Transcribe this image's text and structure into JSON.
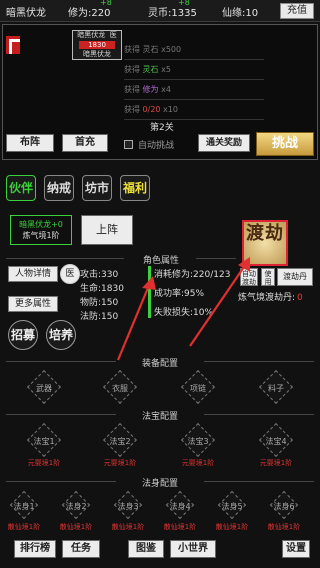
{
  "topbar": {
    "name": "暗黑伏龙",
    "cultivation_label": "修为:220",
    "cultivation_gain": "+8",
    "spirit_label": "灵币:1335",
    "spirit_gain": "+8",
    "immortal_label": "仙缘:10",
    "recharge": "充值"
  },
  "battle": {
    "player_name": "暗黑伏龙  医",
    "player_hp": "1830",
    "player_rank": "暗黑伏龙",
    "logs": [
      {
        "prefix": "获得 ",
        "item": "灵石",
        "suffix": " x500",
        "color": "gray"
      },
      {
        "prefix": "获得 ",
        "item": "灵石",
        "suffix": " x5",
        "color": "green"
      },
      {
        "prefix": "获得 ",
        "item": "修为",
        "suffix": " x4",
        "color": "purple"
      },
      {
        "prefix": "获得 ",
        "item": "0/20",
        "suffix": " x10",
        "color": "red"
      }
    ],
    "stage": "第2关",
    "formation": "布阵",
    "first_recharge": "首充",
    "auto_challenge": "自动挑战",
    "clear_reward": "通关奖励",
    "challenge": "挑战"
  },
  "tabs": [
    "伙伴",
    "纳戒",
    "坊市",
    "福利"
  ],
  "party": {
    "member_name": "暗黑伏龙+0",
    "member_realm": "炼气境1阶",
    "deploy": "上阵"
  },
  "attributes": {
    "title": "角色属性",
    "details_btn": "人物详情",
    "role_btn": "医",
    "more_btn": "更多属性",
    "recruit_btn": "招募",
    "train_btn": "培养",
    "attack": "攻击:330",
    "hp": "生命:1830",
    "phys_def": "物防:150",
    "magic_def": "法防:150",
    "consume": "消耗修为:220/123",
    "success": "成功率:95%",
    "fail_loss": "失败损失:10%"
  },
  "tribulation": {
    "label": "渡劫",
    "auto_btn": "自动渡劫",
    "use_btn": "使用",
    "pill_btn": "渡劫丹",
    "realm_text": "炼气境渡劫丹:",
    "realm_count": "0"
  },
  "equipment": {
    "title": "装备配置",
    "slots": [
      "武器",
      "衣服",
      "项链",
      "料子"
    ]
  },
  "treasure": {
    "title": "法宝配置",
    "slots": [
      "法宝1",
      "法宝2",
      "法宝3",
      "法宝4"
    ],
    "realm": "元婴境1阶"
  },
  "body": {
    "title": "法身配置",
    "slots": [
      "法身1",
      "法身2",
      "法身3",
      "法身4",
      "法身5",
      "法身6"
    ],
    "realm": "散仙境1阶"
  },
  "bottom": {
    "rank": "排行榜",
    "mission": "任务",
    "codex": "图鉴",
    "world": "小世界",
    "settings": "设置"
  },
  "colors": {
    "accent_green": "#3ad13a",
    "arrow_red": "#e03030",
    "challenge_gold": "#c79a3c"
  }
}
